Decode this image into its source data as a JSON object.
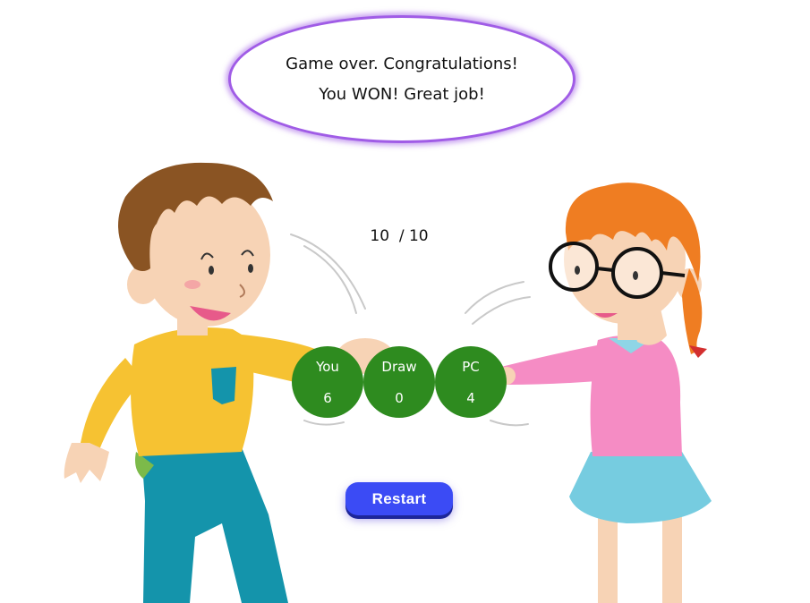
{
  "message": {
    "line1": "Game over. Congratulations!",
    "line2": "You WON! Great job!"
  },
  "round": {
    "text": "10  / 10",
    "current": 10,
    "total": 10
  },
  "scores": {
    "you": {
      "label": "You",
      "value": "6"
    },
    "draw": {
      "label": "Draw",
      "value": "0"
    },
    "pc": {
      "label": "PC",
      "value": "4"
    }
  },
  "restart_button": {
    "label": "Restart"
  },
  "colors": {
    "bubble_border": "#a05ce6",
    "score_circle": "#2e8b1f",
    "button": "#3b4bf5"
  }
}
